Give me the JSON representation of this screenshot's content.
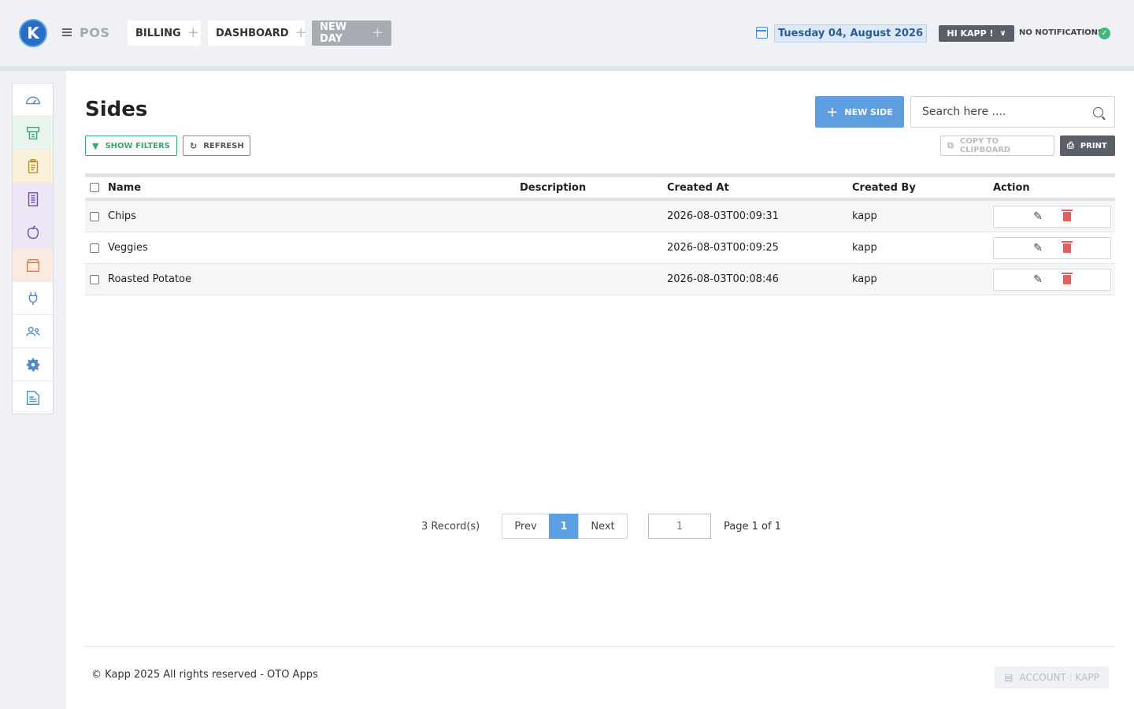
{
  "header": {
    "logo_letter": "K",
    "app_name": "POS",
    "tabs": [
      {
        "label": "BILLING",
        "active": false
      },
      {
        "label": "DASHBOARD",
        "active": false
      },
      {
        "label": "NEW DAY",
        "active": true
      }
    ],
    "date": "Tuesday 04, August 2026",
    "user_label": "HI KAPP !",
    "notifications": "NO NOTIFICATIONS"
  },
  "sidebar": {
    "items": [
      {
        "icon": "dashboard-gauge-icon",
        "color": "#4d88c8"
      },
      {
        "icon": "cash-register-icon",
        "color": "#3aa66a"
      },
      {
        "icon": "clipboard-icon",
        "color": "#b8902e"
      },
      {
        "icon": "receipt-icon",
        "color": "#6a4fa0"
      },
      {
        "icon": "apple-icon",
        "color": "#6a4fa0"
      },
      {
        "icon": "box-icon",
        "color": "#e0784a"
      },
      {
        "icon": "plug-icon",
        "color": "#4d88c8"
      },
      {
        "icon": "users-icon",
        "color": "#4d88c8"
      },
      {
        "icon": "gear-icon",
        "color": "#4d88c8"
      },
      {
        "icon": "document-icon",
        "color": "#4d88c8"
      }
    ]
  },
  "page": {
    "title": "Sides",
    "new_button": "NEW SIDE",
    "search_placeholder": "Search here ....",
    "show_filters": "SHOW FILTERS",
    "refresh": "REFRESH",
    "copy_clipboard": "COPY TO CLIPBOARD",
    "print": "PRINT"
  },
  "table": {
    "columns": [
      "Name",
      "Description",
      "Created At",
      "Created By",
      "Action"
    ],
    "rows": [
      {
        "name": "Chips",
        "description": "",
        "created_at": "2026-08-03T00:09:31",
        "created_by": "kapp"
      },
      {
        "name": "Veggies",
        "description": "",
        "created_at": "2026-08-03T00:09:25",
        "created_by": "kapp"
      },
      {
        "name": "Roasted Potatoe",
        "description": "",
        "created_at": "2026-08-03T00:08:46",
        "created_by": "kapp"
      }
    ]
  },
  "pagination": {
    "records": "3 Record(s)",
    "prev": "Prev",
    "current": "1",
    "next": "Next",
    "goto_placeholder": "1",
    "page_info": "Page 1 of 1"
  },
  "footer": {
    "copyright": "© Kapp 2025 All rights reserved - OTO Apps",
    "account": "ACCOUNT : KAPP"
  },
  "colors": {
    "accent_blue": "#5d9fe0",
    "filters_green": "#3aa66a",
    "delete_red": "#e06060"
  }
}
